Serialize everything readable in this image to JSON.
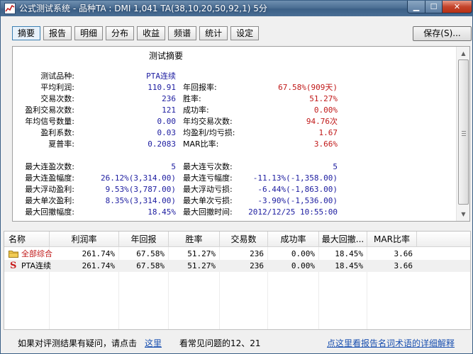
{
  "window": {
    "title": "公式测试系统 - 品种TA : DMI 1,041 TA(38,10,20,50,92,1) 5分"
  },
  "tabs": [
    {
      "label": "摘要",
      "active": true
    },
    {
      "label": "报告",
      "active": false
    },
    {
      "label": "明细",
      "active": false
    },
    {
      "label": "分布",
      "active": false
    },
    {
      "label": "收益",
      "active": false
    },
    {
      "label": "频谱",
      "active": false
    },
    {
      "label": "统计",
      "active": false
    },
    {
      "label": "设定",
      "active": false
    }
  ],
  "save_button": "保存(S)...",
  "summary": {
    "title": "测试摘要",
    "rows": [
      {
        "l1": "测试品种:",
        "v1": "PTA连续",
        "v1_color": "blue",
        "l2": "",
        "v2": "",
        "v2_color": "blue"
      },
      {
        "l1": "平均利润:",
        "v1": "110.91",
        "v1_color": "blue",
        "l2": "年回报率:",
        "v2": "67.58%(909天)",
        "v2_color": "red"
      },
      {
        "l1": "交易次数:",
        "v1": "236",
        "v1_color": "blue",
        "l2": "胜率:",
        "v2": "51.27%",
        "v2_color": "red"
      },
      {
        "l1": "盈利交易次数:",
        "v1": "121",
        "v1_color": "blue",
        "l2": "成功率:",
        "v2": "0.00%",
        "v2_color": "red"
      },
      {
        "l1": "年均信号数量:",
        "v1": "0.00",
        "v1_color": "blue",
        "l2": "年均交易次数:",
        "v2": "94.76次",
        "v2_color": "red"
      },
      {
        "l1": "盈利系数:",
        "v1": "0.03",
        "v1_color": "blue",
        "l2": "均盈利/均亏损:",
        "v2": "1.67",
        "v2_color": "red"
      },
      {
        "l1": "夏普率:",
        "v1": "0.2083",
        "v1_color": "blue",
        "l2": "MAR比率:",
        "v2": "3.66%",
        "v2_color": "red"
      },
      {
        "l1": "",
        "v1": "",
        "v1_color": "blue",
        "l2": "",
        "v2": "",
        "v2_color": "blue"
      },
      {
        "l1": "最大连盈次数:",
        "v1": "5",
        "v1_color": "blue",
        "l2": "最大连亏次数:",
        "v2": "5",
        "v2_color": "blue"
      },
      {
        "l1": "最大连盈幅度:",
        "v1": "26.12%(3,314.00)",
        "v1_color": "blue",
        "l2": "最大连亏幅度:",
        "v2": "-11.13%(-1,358.00)",
        "v2_color": "blue"
      },
      {
        "l1": "最大浮动盈利:",
        "v1": "9.53%(3,787.00)",
        "v1_color": "blue",
        "l2": "最大浮动亏损:",
        "v2": "-6.44%(-1,863.00)",
        "v2_color": "blue"
      },
      {
        "l1": "最大单次盈利:",
        "v1": "8.35%(3,314.00)",
        "v1_color": "blue",
        "l2": "最大单次亏损:",
        "v2": "-3.90%(-1,536.00)",
        "v2_color": "blue"
      },
      {
        "l1": "最大回撤幅度:",
        "v1": "18.45%",
        "v1_color": "blue",
        "l2": "最大回撤时间:",
        "v2": "2012/12/25 10:55:00",
        "v2_color": "blue"
      }
    ]
  },
  "table": {
    "columns": [
      "名称",
      "利润率",
      "年回报",
      "胜率",
      "交易数",
      "成功率",
      "最大回撤...",
      "MAR比率"
    ],
    "rows": [
      {
        "name": "全部综合",
        "icon": "folder-icon",
        "name_color": "red",
        "cells": [
          "261.74%",
          "67.58%",
          "51.27%",
          "236",
          "0.00%",
          "18.45%",
          "3.66"
        ]
      },
      {
        "name": "PTA连续",
        "icon": "s-icon",
        "name_color": "black",
        "cells": [
          "261.74%",
          "67.58%",
          "51.27%",
          "236",
          "0.00%",
          "18.45%",
          "3.66"
        ]
      }
    ]
  },
  "footer": {
    "text1": "如果对评测结果有疑问，请点击",
    "link1": "这里",
    "text2": "看常见问题的12、21",
    "link2": "点这里看报告名词术语的详细解释"
  },
  "icons": {
    "app": "app-chart-icon",
    "s_badge": "S"
  },
  "colors": {
    "blue_value": "#1c1ca0",
    "red_value": "#c01818",
    "link": "#1a50b0",
    "title_bar": "#4c6f94"
  }
}
